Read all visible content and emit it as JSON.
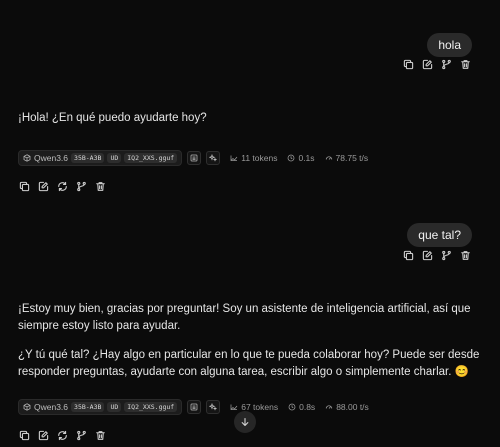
{
  "messages": [
    {
      "role": "user",
      "text": "hola"
    },
    {
      "role": "assistant",
      "paragraphs": [
        "¡Hola! ¿En qué puedo ayudarte hoy?"
      ],
      "meta": {
        "model": "Qwen3.6",
        "tags": [
          "35B-A3B",
          "UD",
          "IQ2_XXS.gguf"
        ],
        "tokens": "11 tokens",
        "time": "0.1s",
        "speed": "78.75 t/s"
      }
    },
    {
      "role": "user",
      "text": "que tal?"
    },
    {
      "role": "assistant",
      "paragraphs": [
        "¡Estoy muy bien, gracias por preguntar! Soy un asistente de inteligencia artificial, así que siempre estoy listo para ayudar.",
        "¿Y tú qué tal? ¿Hay algo en particular en lo que te pueda colaborar hoy? Puede ser desde responder preguntas, ayudarte con alguna tarea, escribir algo o simplemente charlar. 😊"
      ],
      "meta": {
        "model": "Qwen3.6",
        "tags": [
          "35B-A3B",
          "UD",
          "IQ2_XXS.gguf"
        ],
        "tokens": "67 tokens",
        "time": "0.8s",
        "speed": "88.00 t/s"
      }
    }
  ]
}
